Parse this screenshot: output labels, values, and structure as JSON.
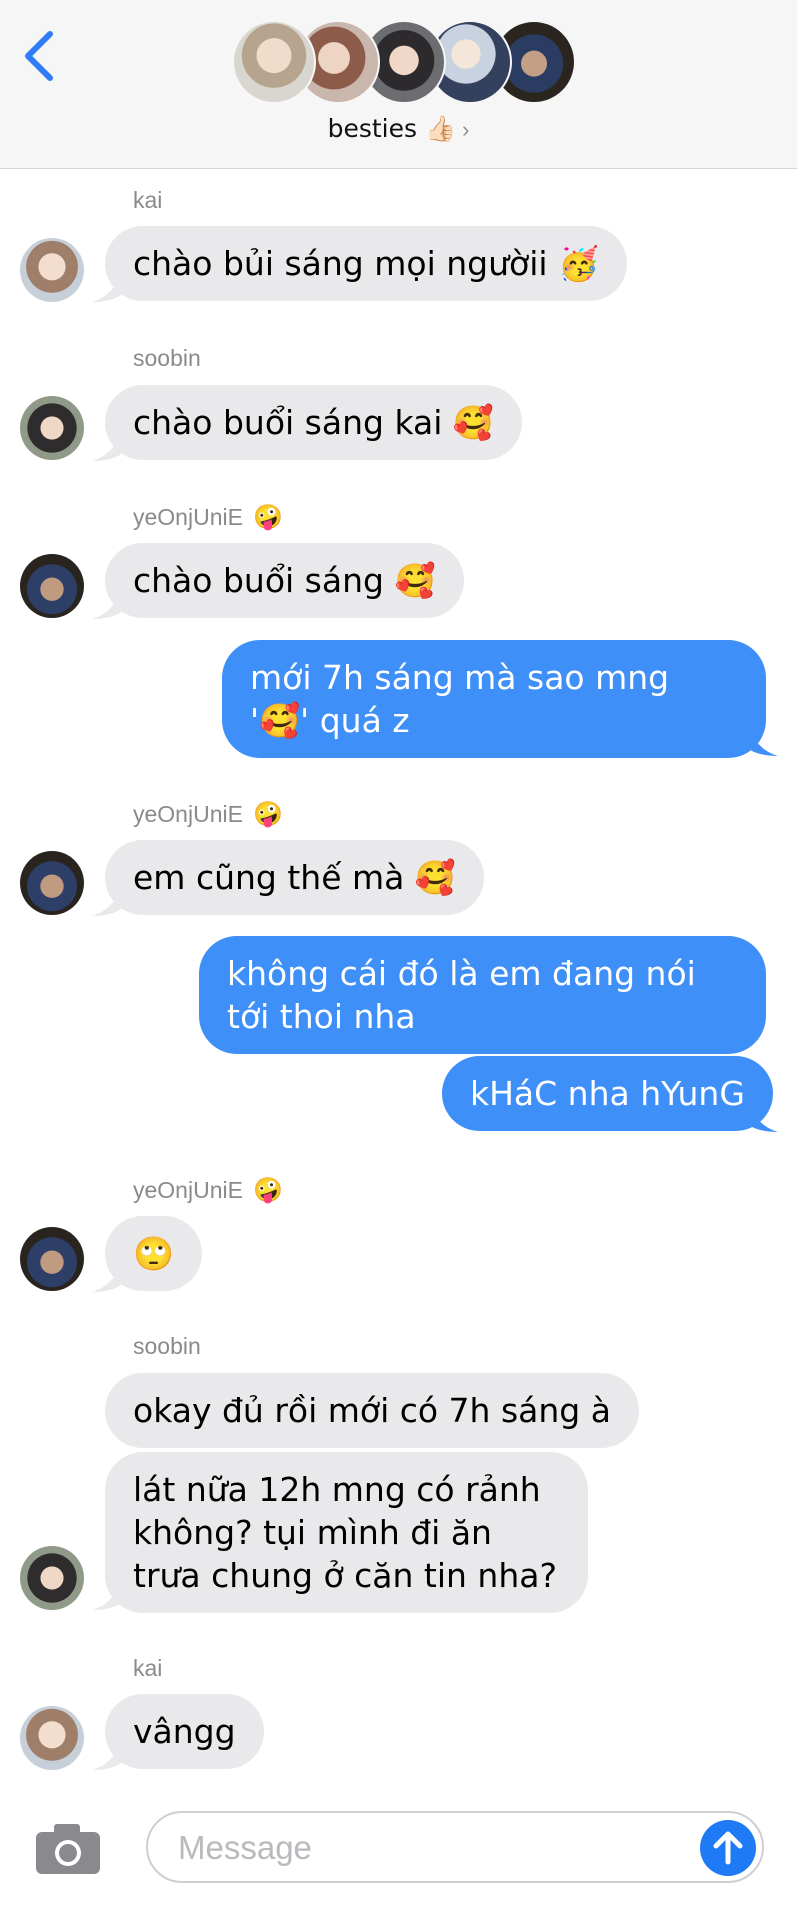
{
  "header": {
    "group_name": "besties 👍🏻",
    "chevron": "›",
    "back_icon": "chevron-left-icon",
    "accent": "#2f7cf6",
    "participants": [
      "avatar-1",
      "avatar-2",
      "avatar-3",
      "avatar-4",
      "avatar-5"
    ]
  },
  "messages": [
    {
      "sender": "kai",
      "text": "chào bủi sáng mọi ngườii 🥳",
      "dir": "in"
    },
    {
      "sender": "soobin",
      "text": "chào buổi sáng kai 🥰",
      "dir": "in"
    },
    {
      "sender": "yeOnjUniE",
      "sender_emoji": "🤪",
      "text": "chào buổi sáng 🥰",
      "dir": "in"
    },
    {
      "text": "mới 7h sáng mà sao mng '🥰' quá z",
      "dir": "out"
    },
    {
      "sender": "yeOnjUniE",
      "sender_emoji": "🤪",
      "text": "em cũng thế mà 🥰",
      "dir": "in"
    },
    {
      "text": "không cái đó là em đang nói tới thoi nha",
      "dir": "out"
    },
    {
      "text": "kHáC nha hYunG",
      "dir": "out"
    },
    {
      "sender": "yeOnjUniE",
      "sender_emoji": "🤪",
      "text": "🙄",
      "dir": "in"
    },
    {
      "sender": "soobin",
      "text": "okay đủ rồi mới có 7h sáng à",
      "dir": "in"
    },
    {
      "text": "lát nữa 12h mng có rảnh không? tụi mình đi ăn trưa chung ở căn tin nha?",
      "dir": "in"
    },
    {
      "sender": "kai",
      "text": "vângg",
      "dir": "in"
    }
  ],
  "composer": {
    "placeholder": "Message",
    "camera_icon": "camera-icon",
    "send_icon": "arrow-up-icon"
  },
  "colors": {
    "incoming_bubble": "#e9e9eb",
    "outgoing_bubble": "#3e8ff7",
    "header_bg": "#f6f6f6"
  }
}
